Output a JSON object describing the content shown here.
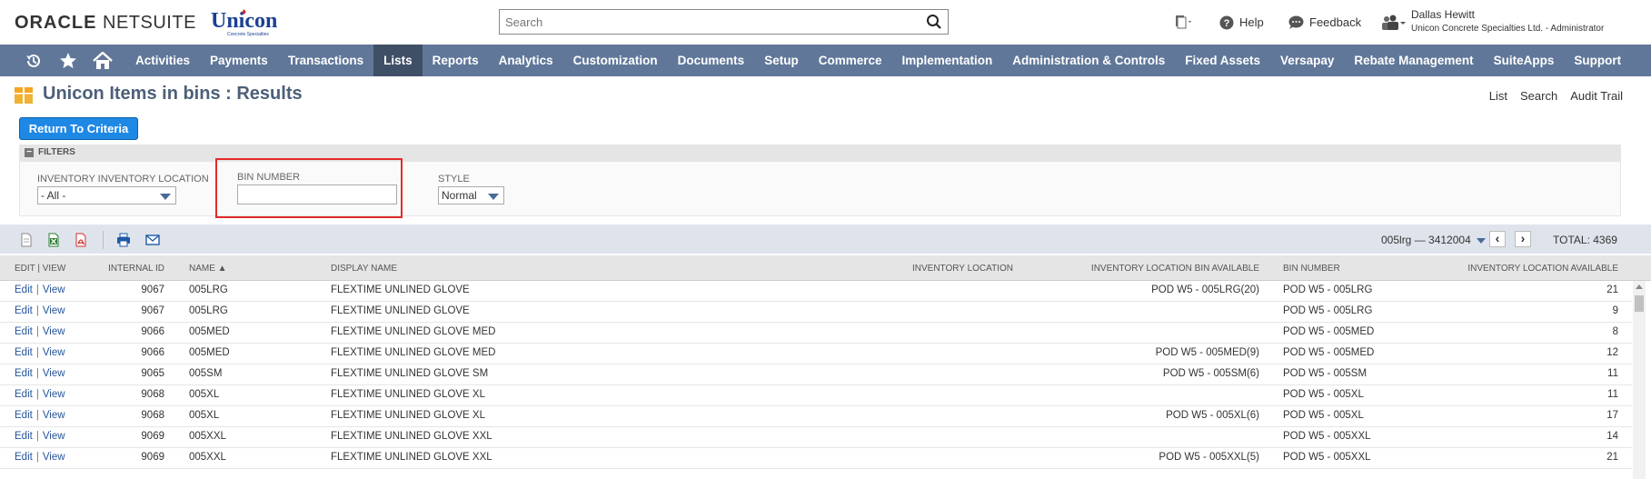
{
  "brand": {
    "oracle": "ORACLE",
    "netsuite": "NETSUITE",
    "company_logo": "Unicon",
    "company_logo_sub": "Concrete Specialties"
  },
  "header": {
    "search_placeholder": "Search",
    "help": "Help",
    "feedback": "Feedback",
    "user_name": "Dallas Hewitt",
    "user_role": "Unicon Concrete Specialties Ltd. - Administrator"
  },
  "nav": {
    "icons": [
      "recent-icon",
      "star-icon",
      "home-icon"
    ],
    "items": [
      {
        "label": "Activities",
        "active": false
      },
      {
        "label": "Payments",
        "active": false
      },
      {
        "label": "Transactions",
        "active": false
      },
      {
        "label": "Lists",
        "active": true
      },
      {
        "label": "Reports",
        "active": false
      },
      {
        "label": "Analytics",
        "active": false
      },
      {
        "label": "Customization",
        "active": false
      },
      {
        "label": "Documents",
        "active": false
      },
      {
        "label": "Setup",
        "active": false
      },
      {
        "label": "Commerce",
        "active": false
      },
      {
        "label": "Implementation",
        "active": false
      },
      {
        "label": "Administration & Controls",
        "active": false
      },
      {
        "label": "Fixed Assets",
        "active": false
      },
      {
        "label": "Versapay",
        "active": false
      },
      {
        "label": "Rebate Management",
        "active": false
      },
      {
        "label": "SuiteApps",
        "active": false
      },
      {
        "label": "Support",
        "active": false
      }
    ]
  },
  "page": {
    "title": "Unicon Items in bins : Results",
    "links": [
      "List",
      "Search",
      "Audit Trail"
    ],
    "return_button": "Return To Criteria"
  },
  "filters": {
    "heading": "FILTERS",
    "location_label": "INVENTORY INVENTORY LOCATION",
    "location_value": "- All -",
    "bin_label": "BIN NUMBER",
    "bin_value": "",
    "style_label": "STYLE",
    "style_value": "Normal"
  },
  "pager": {
    "range": "005lrg — 3412004",
    "total": "TOTAL: 4369"
  },
  "table": {
    "columns": [
      "EDIT | VIEW",
      "INTERNAL ID",
      "NAME ▲",
      "DISPLAY NAME",
      "INVENTORY LOCATION",
      "INVENTORY LOCATION BIN AVAILABLE",
      "BIN NUMBER",
      "INVENTORY LOCATION AVAILABLE"
    ],
    "edit": "Edit",
    "view": "View",
    "rows": [
      {
        "id": "9067",
        "name": "005LRG",
        "display": "FLEXTIME UNLINED GLOVE",
        "location": "",
        "bin_avail": "POD W5 - 005LRG(20)",
        "bin": "POD W5 - 005LRG",
        "avail": "21"
      },
      {
        "id": "9067",
        "name": "005LRG",
        "display": "FLEXTIME UNLINED GLOVE",
        "location": "",
        "bin_avail": "",
        "bin": "POD W5 - 005LRG",
        "avail": "9"
      },
      {
        "id": "9066",
        "name": "005MED",
        "display": "FLEXTIME UNLINED GLOVE MED",
        "location": "",
        "bin_avail": "",
        "bin": "POD W5 - 005MED",
        "avail": "8"
      },
      {
        "id": "9066",
        "name": "005MED",
        "display": "FLEXTIME UNLINED GLOVE MED",
        "location": "",
        "bin_avail": "POD W5 - 005MED(9)",
        "bin": "POD W5 - 005MED",
        "avail": "12"
      },
      {
        "id": "9065",
        "name": "005SM",
        "display": "FLEXTIME UNLINED GLOVE SM",
        "location": "",
        "bin_avail": "POD W5 - 005SM(6)",
        "bin": "POD W5 - 005SM",
        "avail": "11"
      },
      {
        "id": "9068",
        "name": "005XL",
        "display": "FLEXTIME UNLINED GLOVE XL",
        "location": "",
        "bin_avail": "",
        "bin": "POD W5 - 005XL",
        "avail": "11"
      },
      {
        "id": "9068",
        "name": "005XL",
        "display": "FLEXTIME UNLINED GLOVE XL",
        "location": "",
        "bin_avail": "POD W5 - 005XL(6)",
        "bin": "POD W5 - 005XL",
        "avail": "17"
      },
      {
        "id": "9069",
        "name": "005XXL",
        "display": "FLEXTIME UNLINED GLOVE XXL",
        "location": "",
        "bin_avail": "",
        "bin": "POD W5 - 005XXL",
        "avail": "14"
      },
      {
        "id": "9069",
        "name": "005XXL",
        "display": "FLEXTIME UNLINED GLOVE XXL",
        "location": "",
        "bin_avail": "POD W5 - 005XXL(5)",
        "bin": "POD W5 - 005XXL",
        "avail": "21"
      }
    ]
  },
  "colors": {
    "nav_bg": "#607799",
    "nav_active": "#3f4f66",
    "title": "#4d5f79",
    "button": "#1e88e5",
    "link": "#255599",
    "highlight": "#e32b2b"
  }
}
